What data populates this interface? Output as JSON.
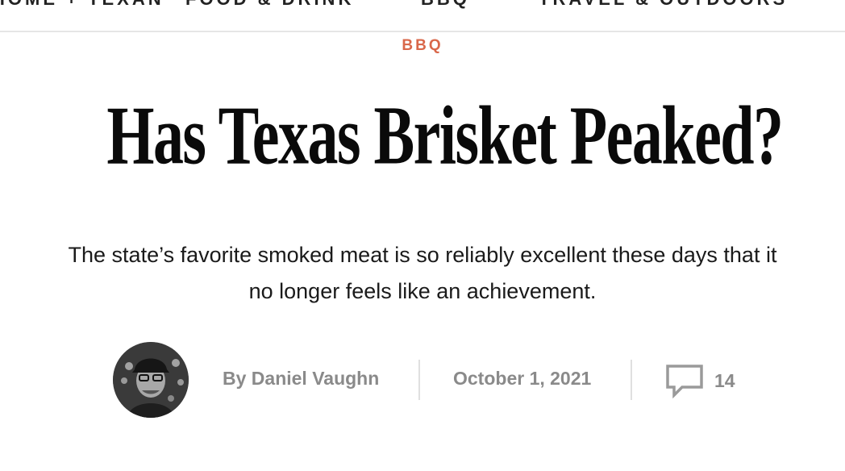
{
  "nav": {
    "items": [
      {
        "label": "HOME + TEXAN"
      },
      {
        "label": "FOOD & DRINK"
      },
      {
        "label": "BBQ"
      },
      {
        "label": "TRAVEL & OUTDOORS"
      }
    ]
  },
  "article": {
    "category": "BBQ",
    "headline": "Has Texas Brisket Peaked?",
    "dek": "The state’s favorite smoked meat is so reliably excellent these days that it no longer feels like an achievement.",
    "byline": "By Daniel Vaughn",
    "date": "October 1, 2021",
    "comment_count": "14"
  },
  "icons": {
    "avatar": "author-photo",
    "comments": "speech-bubble-icon"
  },
  "colors": {
    "category_accent": "#d9674a",
    "meta_text": "#8a8a8a",
    "divider": "#e0e0e0"
  }
}
